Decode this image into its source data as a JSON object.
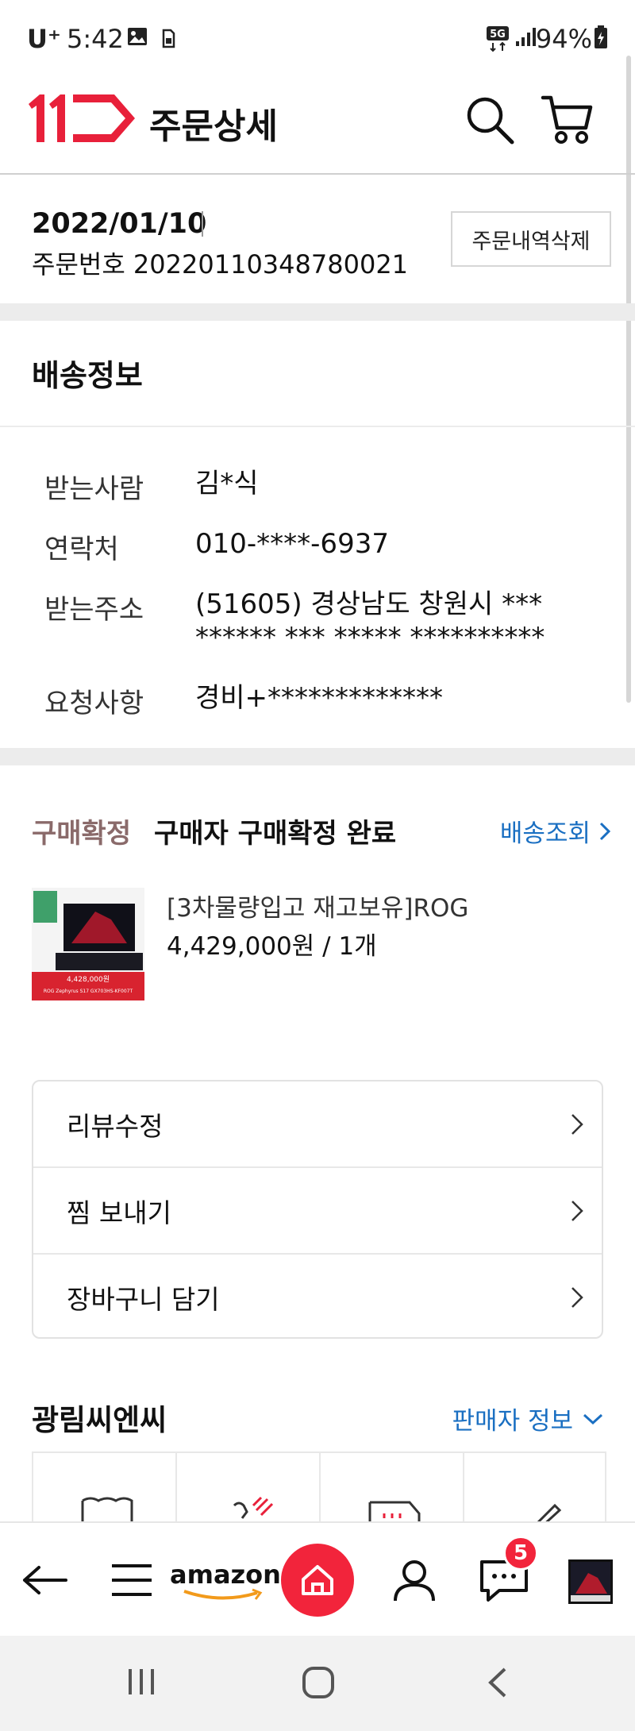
{
  "status_bar": {
    "carrier": "U⁺",
    "time": "5:42",
    "battery": "94%",
    "network_badge": "5G",
    "icons": [
      "image-icon",
      "sim-icon",
      "signal-icon",
      "battery-icon"
    ]
  },
  "header": {
    "logo_text": "11",
    "title": "주문상세",
    "icons": [
      "search-icon",
      "cart-icon"
    ],
    "brand_color": "#e8203a"
  },
  "order": {
    "date": "2022/01/10",
    "number": "주문번호 20220110348780021",
    "delete_label": "주문내역삭제"
  },
  "shipping": {
    "title": "배송정보",
    "rows": [
      {
        "label": "받는사람",
        "value": "김*식"
      },
      {
        "label": "연락처",
        "value": "010-****-6937"
      },
      {
        "label": "받는주소",
        "value": "(51605) 경상남도 창원시 ***",
        "value2": "****** *** ***** **********"
      },
      {
        "label": "요청사항",
        "value": "경비+*************"
      }
    ]
  },
  "purchase": {
    "status_label": "구매확정",
    "status_text": "구매자 구매확정 완료",
    "tracking_link": "배송조회",
    "product": {
      "name": "[3차물량입고 재고보유]ROG",
      "price": "4,429,000원 / 1개",
      "thumb_caption": "ROG Zephyrus S17 GX703HS-KF007T",
      "thumb_price": "4,428,000원"
    },
    "link_color": "#1a6fc2"
  },
  "actions": [
    {
      "label": "리뷰수정"
    },
    {
      "label": "찜 보내기"
    },
    {
      "label": "장바구니 담기"
    }
  ],
  "seller": {
    "name": "광림씨엔씨",
    "info_link": "판매자 정보"
  },
  "bottom_nav": {
    "amazon_label": "amazon",
    "badge_count": "5",
    "items": [
      "back-icon",
      "menu-icon",
      "amazon-logo",
      "home-icon",
      "user-icon",
      "chat-icon",
      "recent-item"
    ],
    "home_color": "#f2243b"
  },
  "android_nav": {
    "items": [
      "recent-apps-icon",
      "home-button-icon",
      "back-button-icon"
    ]
  }
}
